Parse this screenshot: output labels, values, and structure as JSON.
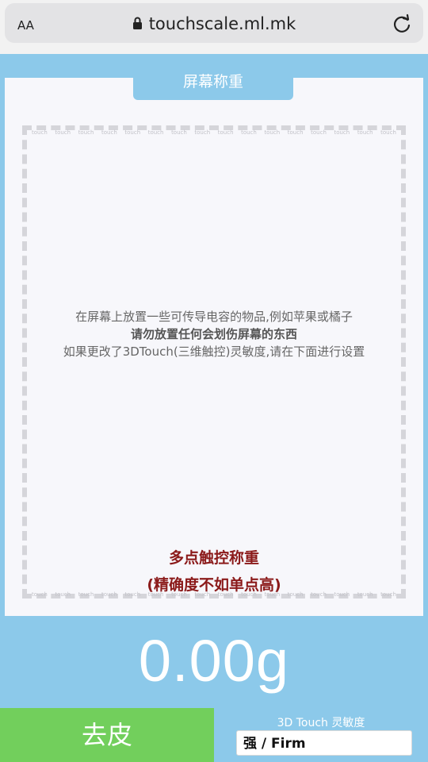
{
  "browser": {
    "text_size_button": "AA",
    "url": "touchscale.ml.mk"
  },
  "header": {
    "title": "屏幕称重"
  },
  "scale_area": {
    "ruler_label": "touch",
    "instructions": [
      "在屏幕上放置一些可传导电容的物品,例如苹果或橘子",
      "请勿放置任何会划伤屏幕的东西",
      "如果更改了3DTouch(三维触控)灵敏度,请在下面进行设置"
    ],
    "multi_touch_title": "多点触控称重",
    "multi_touch_note": "(精确度不如单点高)"
  },
  "weight": {
    "value": "0.00g"
  },
  "controls": {
    "tare_label": "去皮",
    "sensitivity_label": "3D Touch 灵敏度",
    "sensitivity_value": "强 / Firm"
  },
  "colors": {
    "accent_blue": "#8cc9ea",
    "tare_green": "#72cf5c",
    "warning_red": "#8b1a1a"
  }
}
